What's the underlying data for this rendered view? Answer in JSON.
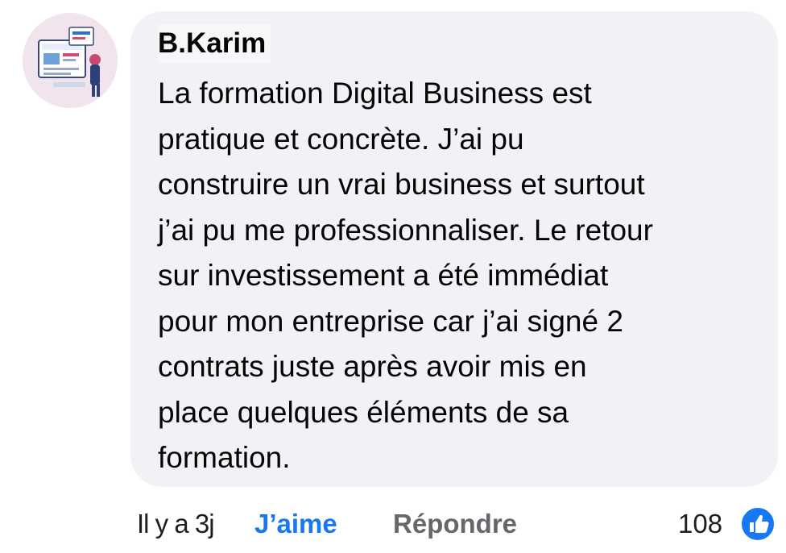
{
  "comment": {
    "author": "B.Karim",
    "text_lines": [
      "La formation Digital Business est",
      "pratique et concrète. J’ai pu",
      "construire un vrai business et surtout",
      "j’ai pu me professionnaliser. Le retour",
      "sur investissement a été immédiat",
      "pour mon entreprise car j’ai signé 2",
      "contrats juste après avoir mis en",
      "place quelques éléments de sa",
      "formation."
    ],
    "time": "Il y a 3j",
    "like_label": "J’aime",
    "reply_label": "Répondre",
    "reaction_count": "108",
    "reaction_icon": "thumbs-up-icon",
    "colors": {
      "bubble": "#f0f2f5",
      "like": "#1877f2",
      "reply": "#65676b"
    }
  }
}
